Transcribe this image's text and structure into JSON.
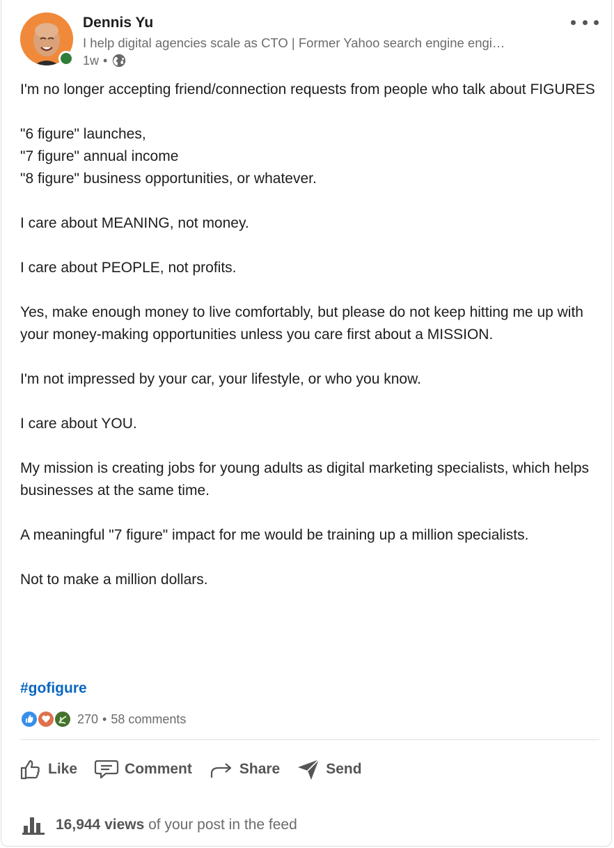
{
  "author": {
    "name": "Dennis Yu",
    "headline": "I help digital agencies scale as CTO | Former Yahoo search engine engi…",
    "time": "1w",
    "separator": "•",
    "visibility_icon": "globe-icon",
    "online": true
  },
  "post": {
    "paragraphs": [
      "I'm no longer accepting friend/connection requests from people who talk about FIGURES",
      "\"6 figure\" launches,\n\"7 figure\" annual income\n\"8 figure\" business opportunities, or whatever.",
      "I care about MEANING, not money.",
      "I care about PEOPLE, not profits.",
      "Yes, make enough money to live comfortably, but please do not keep hitting me up with your money-making opportunities unless you care first about a MISSION.",
      "I'm not impressed by your car, your lifestyle, or who you know.",
      "I care about YOU.",
      "My mission is creating jobs for young adults as digital marketing specialists, which helps businesses at the same time.",
      "A meaningful \"7 figure\" impact for me would be training up a million specialists.",
      "Not to make a million dollars."
    ],
    "hashtag": "#gofigure"
  },
  "social": {
    "reaction_icons": [
      "like-reaction-icon",
      "love-reaction-icon",
      "celebrate-reaction-icon"
    ],
    "reaction_count": "270",
    "separator": "•",
    "comments": "58 comments"
  },
  "actions": {
    "like": "Like",
    "comment": "Comment",
    "share": "Share",
    "send": "Send"
  },
  "views": {
    "count": "16,944 views",
    "suffix": "of your post in the feed"
  },
  "colors": {
    "accent": "#0a66c2",
    "presence": "#2f7d3a",
    "muted_text": "#6b6b6b",
    "avatar_bg": "#f08a3a"
  }
}
